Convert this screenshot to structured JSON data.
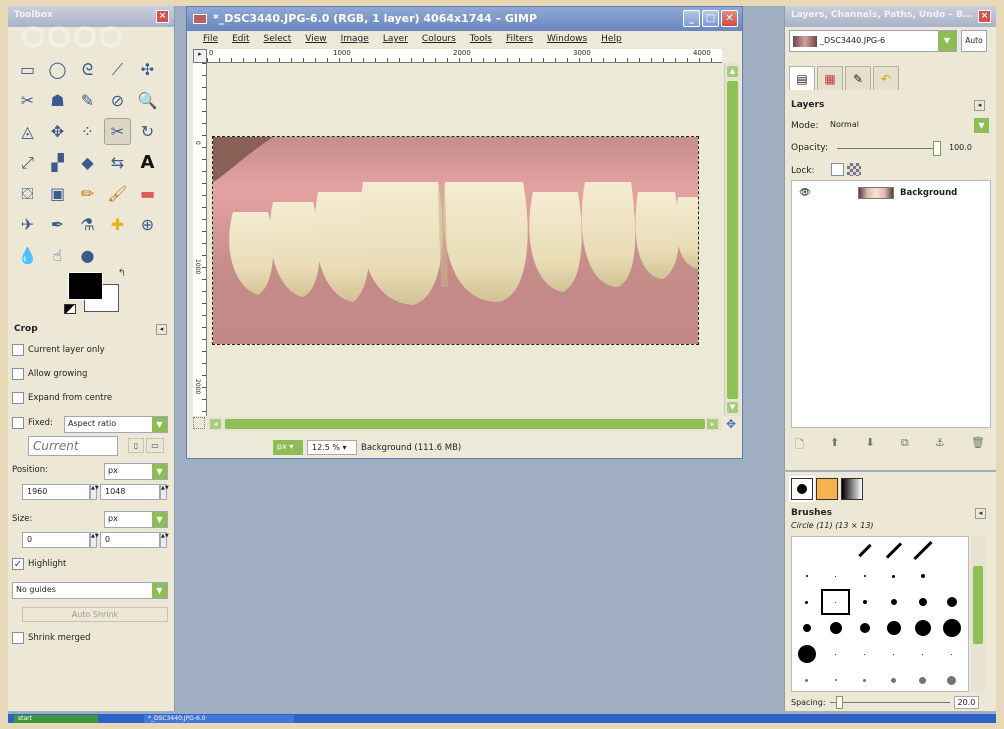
{
  "toolbox": {
    "title": "Toolbox",
    "tool_icons": [
      "rect-select-icon",
      "ellipse-select-icon",
      "free-select-icon",
      "fuzzy-select-icon",
      "color-select-icon",
      "scissors-icon",
      "foreground-select-icon",
      "paths-icon",
      "color-picker-icon",
      "zoom-icon",
      "measure-icon",
      "move-icon",
      "align-icon",
      "crop-icon",
      "rotate-icon",
      "scale-icon",
      "shear-icon",
      "perspective-icon",
      "flip-icon",
      "text-icon",
      "bucket-fill-icon",
      "blend-icon",
      "pencil-icon",
      "paintbrush-icon",
      "eraser-icon",
      "airbrush-icon",
      "ink-icon",
      "clone-icon",
      "heal-icon",
      "perspective-clone-icon",
      "blur-icon",
      "smudge-icon",
      "dodge-burn-icon"
    ],
    "tool_glyphs": [
      "▭",
      "◯",
      "ᘓ",
      "⟋",
      "✣",
      "✂",
      "☗",
      "✎",
      "⊘",
      "🔍",
      "◬",
      "✥",
      "⁘",
      "✂",
      "↻",
      "⤢",
      "▞",
      "◆",
      "⇆",
      "A",
      "⛋",
      "▣",
      "✏",
      "🖌",
      "▬",
      "✈",
      "✒",
      "⚗",
      "✚",
      "⊕",
      "💧",
      "☝",
      "●"
    ],
    "options": {
      "heading": "Crop",
      "current_layer_only": "Current layer only",
      "allow_growing": "Allow growing",
      "expand_from_centre": "Expand from centre",
      "fixed_label": "Fixed:",
      "fixed_value": "Aspect ratio",
      "current_value": "Current",
      "position_label": "Position:",
      "position_unit": "px",
      "position_x": "1960",
      "position_y": "1048",
      "size_label": "Size:",
      "size_unit": "px",
      "size_w": "0",
      "size_h": "0",
      "highlight": "Highlight",
      "guides": "No guides",
      "auto_shrink": "Auto Shrink",
      "shrink_merged": "Shrink merged"
    }
  },
  "image_window": {
    "title": "*_DSC3440.JPG-6.0 (RGB, 1 layer) 4064x1744 – GIMP",
    "menus": [
      "File",
      "Edit",
      "Select",
      "View",
      "Image",
      "Layer",
      "Colours",
      "Tools",
      "Filters",
      "Windows",
      "Help"
    ],
    "ruler_h": [
      "0",
      "1000",
      "2000",
      "3000",
      "4000"
    ],
    "ruler_v": [
      "0",
      "1000",
      "2000"
    ],
    "status_unit": "px",
    "status_zoom": "12.5 %",
    "status_text": "Background (111.6 MB)"
  },
  "layers_dock": {
    "title": "Layers, Channels, Paths, Undo – B...",
    "image_name": "_DSC3440.JPG-6",
    "auto_label": "Auto",
    "panel_title": "Layers",
    "mode_label": "Mode:",
    "mode_value": "Normal",
    "opacity_label": "Opacity:",
    "opacity_value": "100.0",
    "lock_label": "Lock:",
    "layer_name": "Background"
  },
  "brushes_dock": {
    "title": "Brushes",
    "selected_brush": "Circle (11) (13 × 13)",
    "spacing_label": "Spacing:",
    "spacing_value": "20.0"
  },
  "taskbar": {
    "start": "start",
    "item": "*_DSC3440.JPG-6.0"
  },
  "colors": {
    "accent_green": "#8ebd57",
    "titlebar_active": "#6b86bf",
    "desktop": "#9fafc1"
  }
}
